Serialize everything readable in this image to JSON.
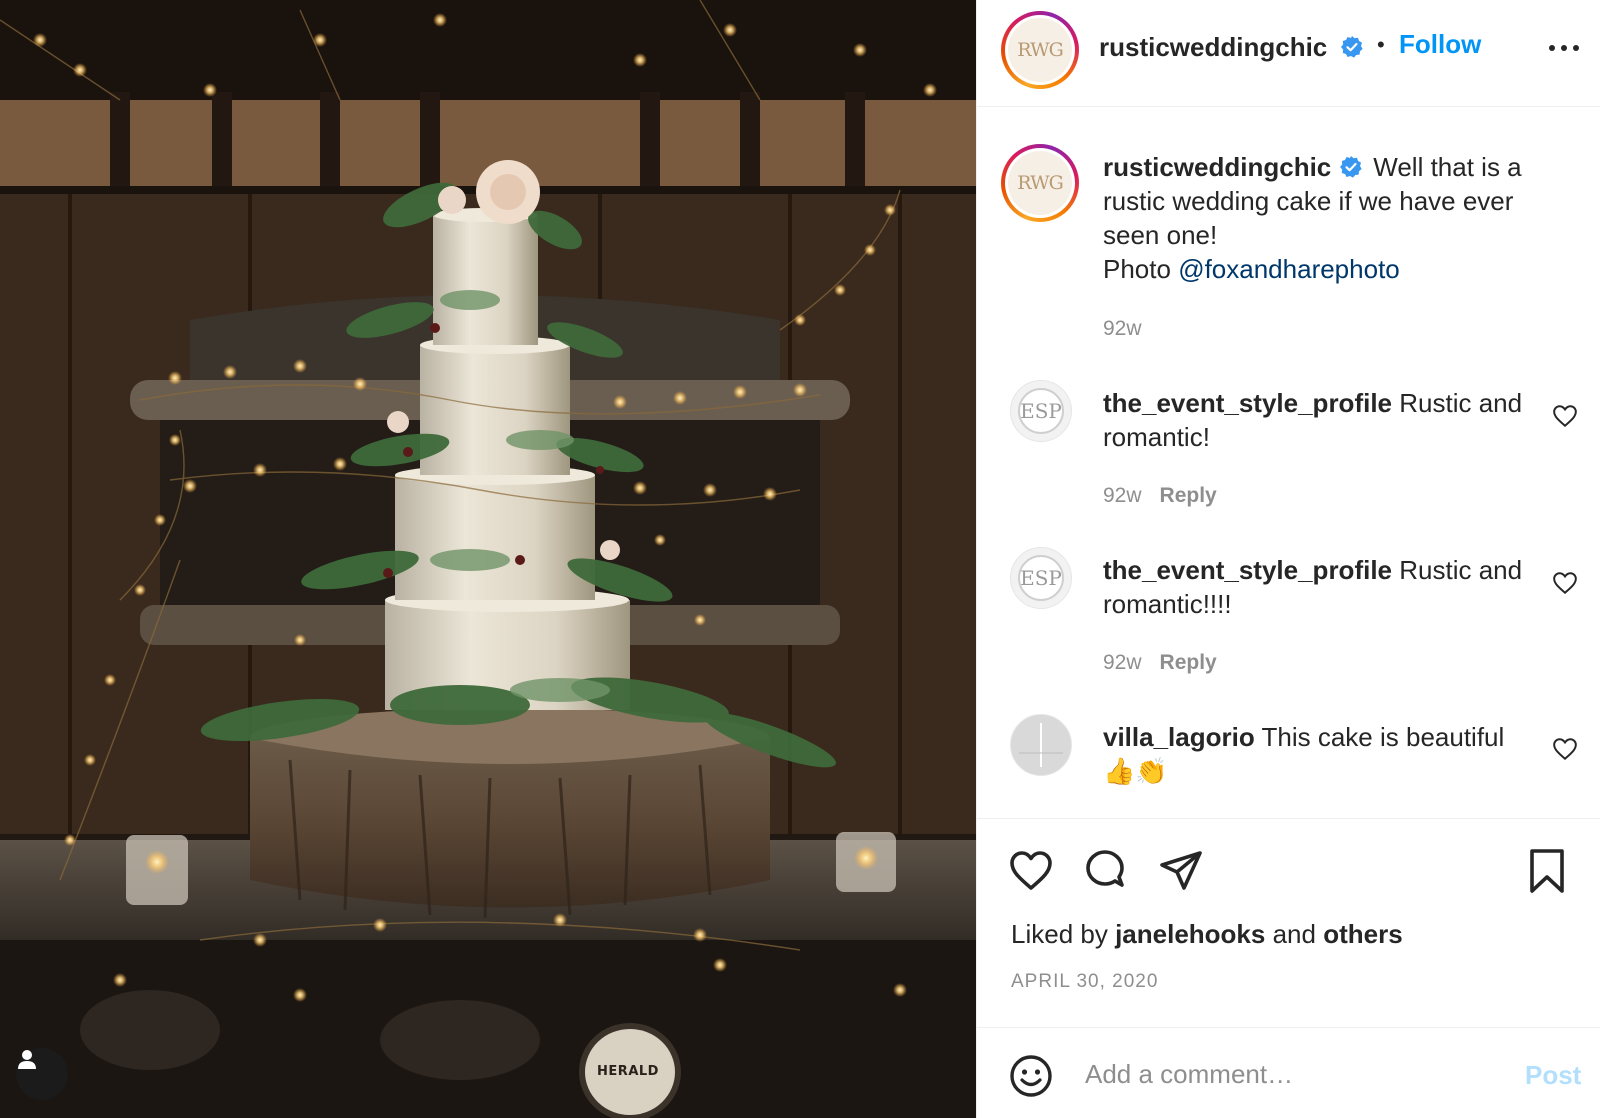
{
  "post": {
    "photo_alt": "Rustic semi-naked wedding cake with greenery on a tree-slice stand, fairy lights",
    "stove_badge_text": "HERALD",
    "user_tag_icon": "person-icon"
  },
  "header": {
    "avatar_text": "RWG",
    "username": "rusticweddingchic",
    "separator": "•",
    "follow_label": "Follow",
    "more_icon": "more-horizontal-icon"
  },
  "caption": {
    "avatar_text": "RWG",
    "username": "rusticweddingchic",
    "text": "Well that is a rustic wedding cake if we have ever seen one!",
    "photo_prefix": "Photo",
    "mention": "@foxandharephoto",
    "time": "92w"
  },
  "comments": [
    {
      "avatar_text": "ESP",
      "username": "the_event_style_profile",
      "text": "Rustic and romantic!",
      "time": "92w",
      "reply_label": "Reply"
    },
    {
      "avatar_text": "ESP",
      "username": "the_event_style_profile",
      "text": "Rustic and romantic!!!!",
      "time": "92w",
      "reply_label": "Reply"
    },
    {
      "avatar_text": "",
      "username": "villa_lagorio",
      "text": "This cake is beautiful",
      "emojis": "👍👏"
    }
  ],
  "actions": {
    "like_icon": "heart-icon",
    "comment_icon": "comment-icon",
    "share_icon": "paper-plane-icon",
    "save_icon": "bookmark-icon",
    "liked_prefix": "Liked by",
    "liked_user": "janelehooks",
    "liked_and": "and",
    "liked_others": "others",
    "date": "APRIL 30, 2020"
  },
  "add_comment": {
    "emoji_icon": "smiley-icon",
    "placeholder": "Add a comment…",
    "post_label": "Post"
  },
  "colors": {
    "accent": "#0095f6",
    "verified": "#3897f0",
    "mention": "#00376b",
    "muted": "#8e8e8e",
    "post_disabled": "#b2dffc"
  }
}
